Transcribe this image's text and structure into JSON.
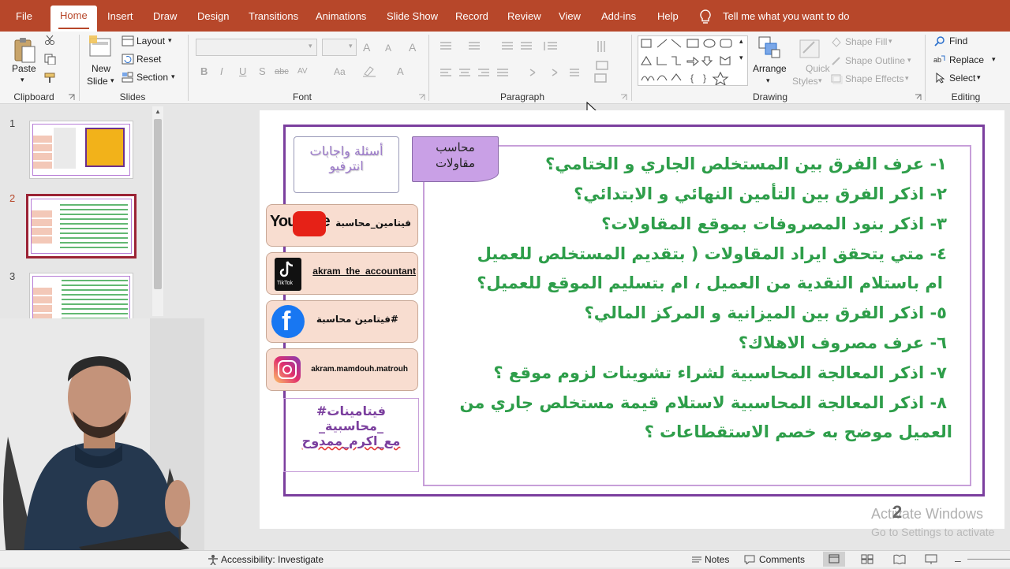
{
  "tabs": [
    {
      "label": "File"
    },
    {
      "label": "Home"
    },
    {
      "label": "Insert"
    },
    {
      "label": "Draw"
    },
    {
      "label": "Design"
    },
    {
      "label": "Transitions"
    },
    {
      "label": "Animations"
    },
    {
      "label": "Slide Show"
    },
    {
      "label": "Record"
    },
    {
      "label": "Review"
    },
    {
      "label": "View"
    },
    {
      "label": "Add-ins"
    },
    {
      "label": "Help"
    }
  ],
  "active_tab": "Home",
  "tell_me": "Tell me what you want to do",
  "ribbon": {
    "clipboard": {
      "paste": "Paste",
      "group": "Clipboard"
    },
    "slides": {
      "new_slide_1": "New",
      "new_slide_2": "Slide",
      "layout": "Layout",
      "reset": "Reset",
      "section": "Section",
      "group": "Slides"
    },
    "font": {
      "group": "Font",
      "bold": "B",
      "italic": "I",
      "underline": "U",
      "strike": "S",
      "abc": "abc",
      "av": "AV",
      "aa": "Aa",
      "a_color": "A"
    },
    "paragraph": {
      "group": "Paragraph"
    },
    "drawing": {
      "arrange": "Arrange",
      "quick_styles_1": "Quick",
      "quick_styles_2": "Styles",
      "shape_fill": "Shape Fill",
      "shape_outline": "Shape Outline",
      "shape_effects": "Shape Effects",
      "group": "Drawing"
    },
    "editing": {
      "find": "Find",
      "replace": "Replace",
      "select": "Select",
      "group": "Editing"
    }
  },
  "thumbnails": [
    {
      "num": "1"
    },
    {
      "num": "2"
    },
    {
      "num": "3"
    }
  ],
  "slide": {
    "tag_line1": "محاسب",
    "tag_line2": "مقاولات",
    "badge_line1": "أسئلة واجابات",
    "badge_line2": "انترفيو",
    "social": [
      {
        "platform": "YouTube",
        "handle": "فيتامين_محاسبة"
      },
      {
        "platform": "TikTok",
        "handle": "akram_the_accountant"
      },
      {
        "platform": "Facebook",
        "handle": "#فيتامين محاسبة"
      },
      {
        "platform": "Instagram",
        "handle": "akram.mamdouh.matrouh"
      }
    ],
    "hashtag_line1": "#فيتامينات",
    "hashtag_line2": "_محاسبية_",
    "hashtag_line3": "مع_اكرم_ممدوح",
    "questions": [
      "١- عرف الفرق بين المستخلص الجاري و الختامي؟",
      "٢- اذكر الفرق بين التأمين النهائي و الابتدائي؟",
      "٣- اذكر بنود المصروفات بموقع المقاولات؟",
      "٤- متي يتحقق ايراد المقاولات ( بتقديم المستخلص للعميل",
      "ام باستلام النقدية من العميل ، ام بتسليم الموقع للعميل؟",
      "٥- اذكر الفرق بين الميزانية و المركز المالي؟",
      "٦- عرف مصروف الاهلاك؟",
      "٧- اذكر المعالجة المحاسبية لشراء تشوينات لزوم موقع ؟",
      "٨- اذكر المعالجة المحاسبية لاستلام قيمة مستخلص جاري من",
      "العميل موضح به خصم الاستقطاعات ؟"
    ]
  },
  "watermark": {
    "line1": "Activate Windows",
    "line2": "Go to Settings to activate",
    "overlay_digit": "2"
  },
  "status": {
    "accessibility": "Accessibility: Investigate",
    "notes": "Notes",
    "comments": "Comments"
  },
  "colors": {
    "accent": "#b7472a",
    "slide_frame": "#7b3f9e",
    "question_text": "#2e9e4a",
    "badge_purple": "#c9a0e6"
  }
}
